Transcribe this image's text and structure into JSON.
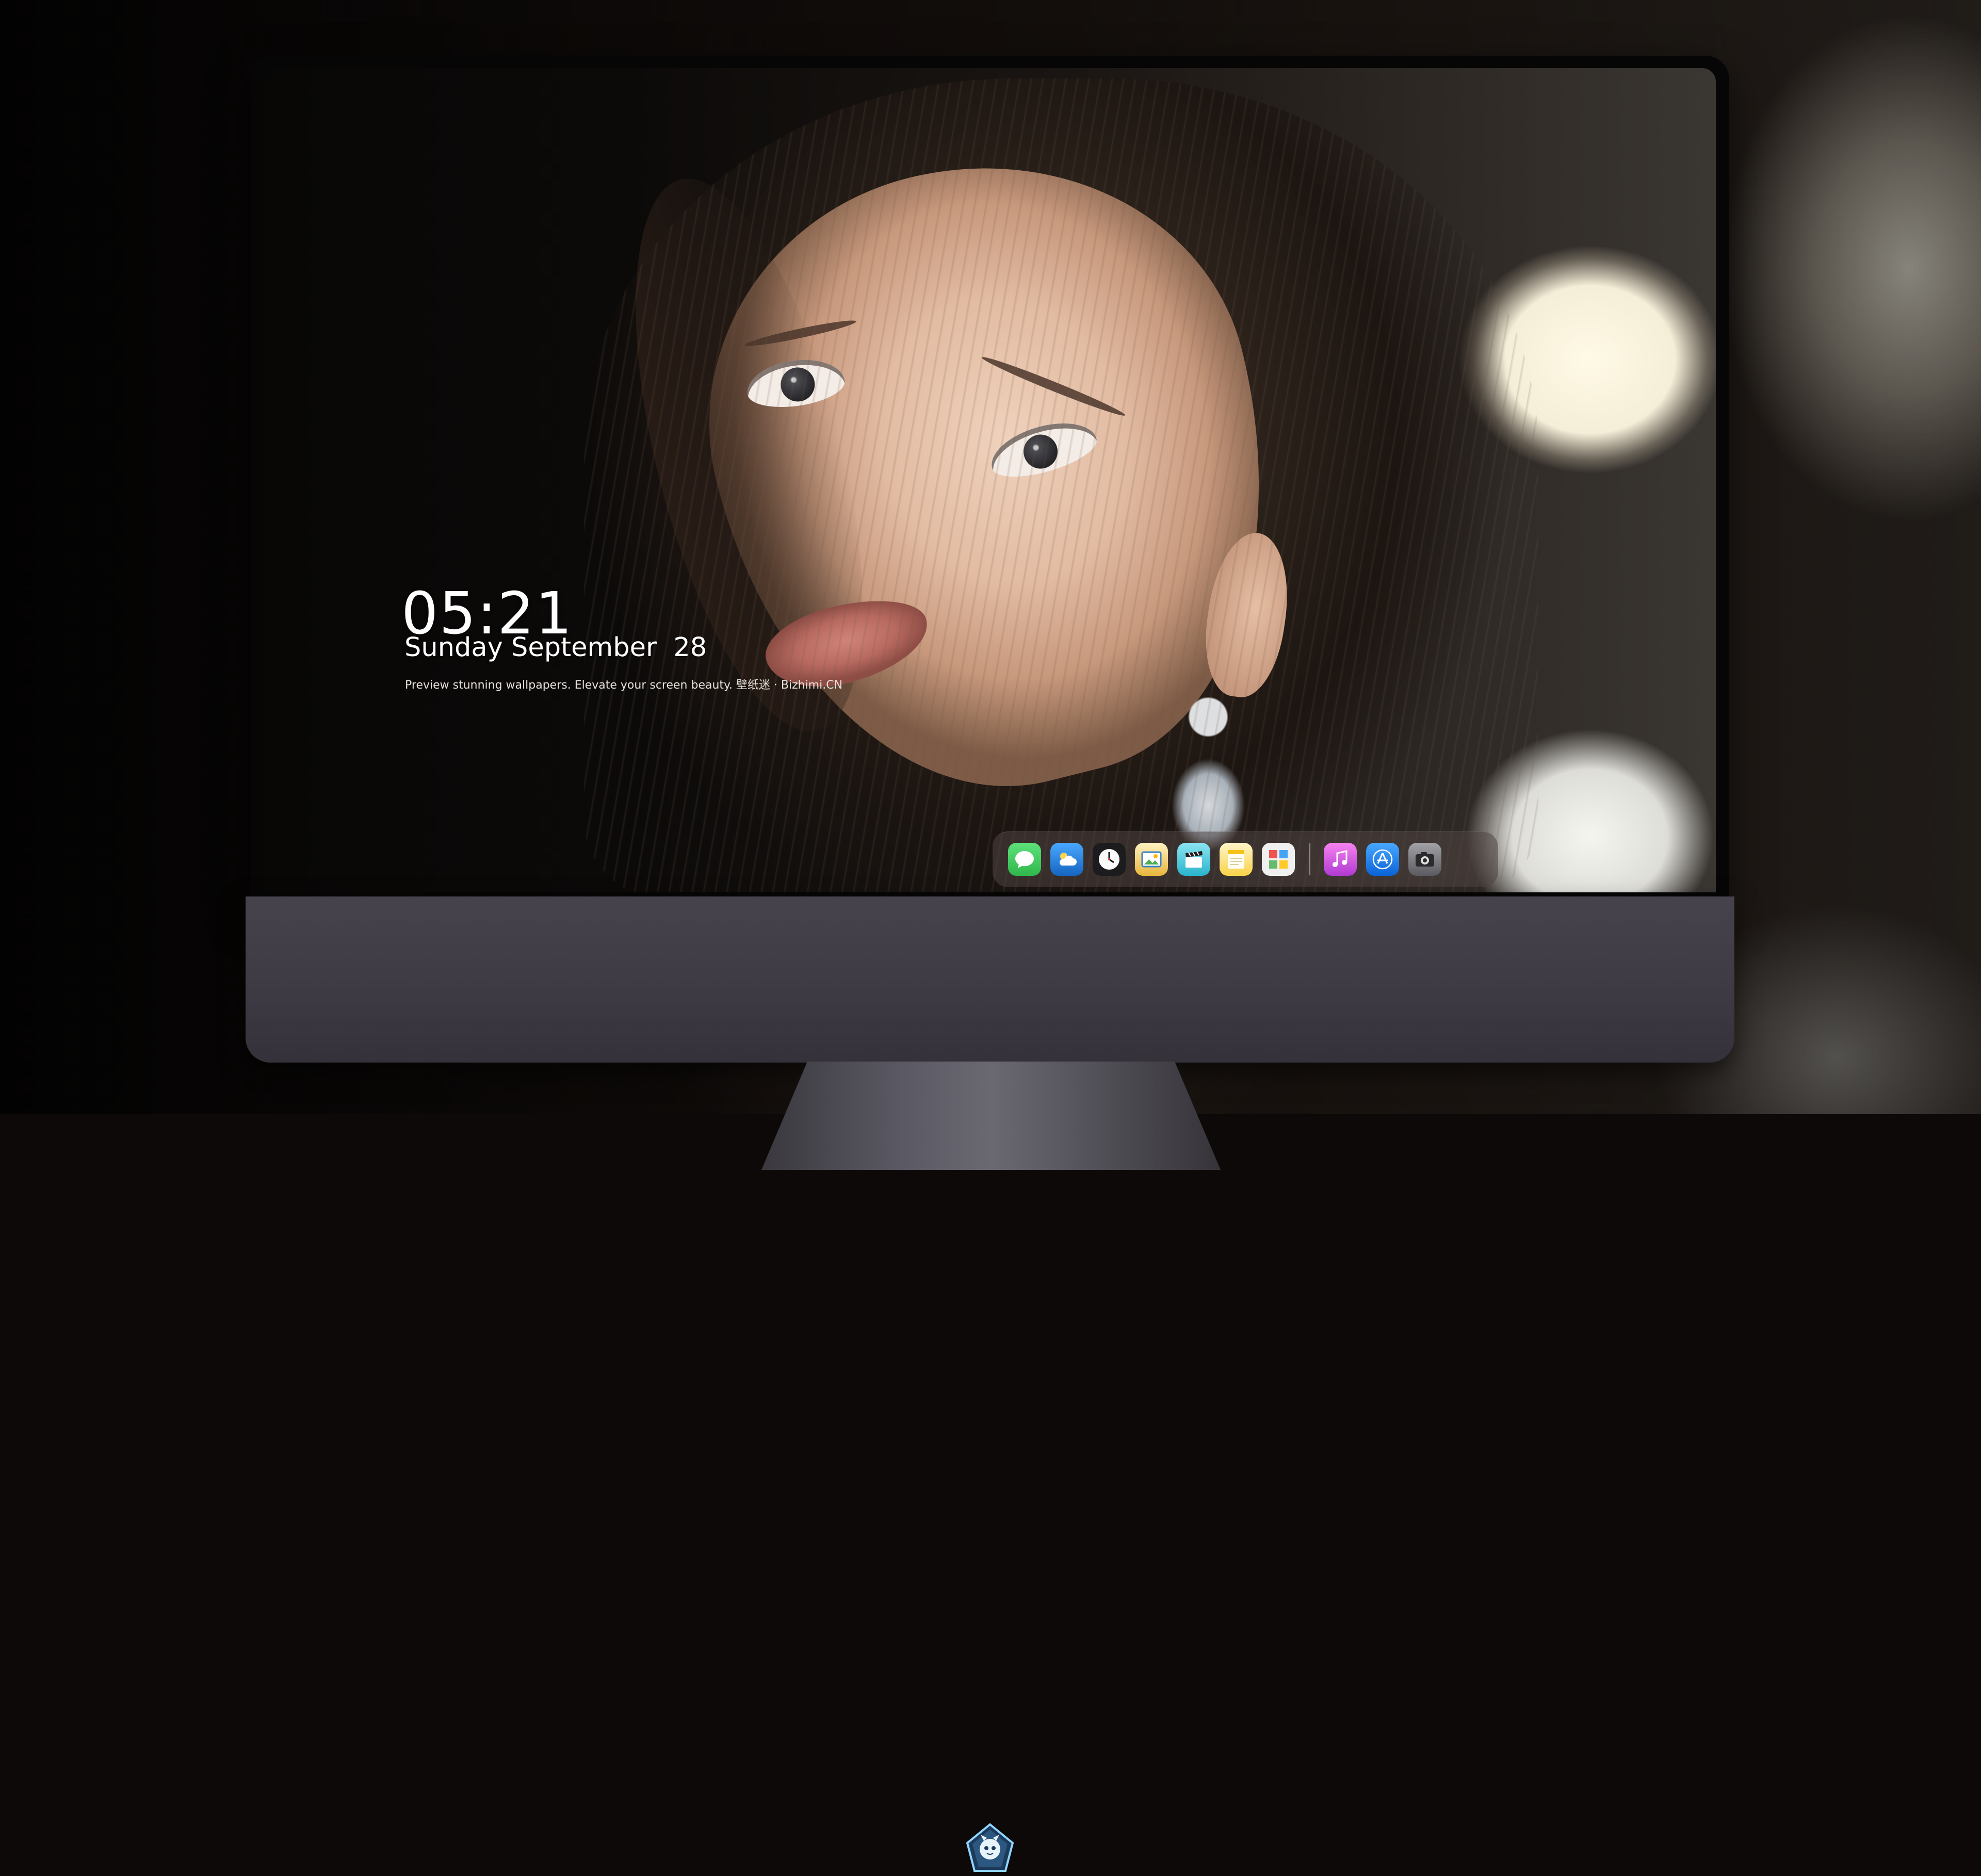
{
  "lock_screen": {
    "time": "05:21",
    "date": "Sunday September  28",
    "tagline": "Preview stunning wallpapers. Elevate your screen beauty. 壁纸迷 · Bizhimi.CN"
  },
  "dock": {
    "apps": [
      {
        "name": "messages",
        "icon": "chat-bubble-icon",
        "color": "#35c759"
      },
      {
        "name": "weather",
        "icon": "cloud-sun-icon",
        "color": "#1e88e5"
      },
      {
        "name": "clock",
        "icon": "clock-icon",
        "color": "#ffffff"
      },
      {
        "name": "preview",
        "icon": "image-viewer-icon",
        "color": "#f3c24c"
      },
      {
        "name": "final-cut",
        "icon": "clapperboard-icon",
        "color": "#5fd0e4"
      },
      {
        "name": "notes",
        "icon": "notes-icon",
        "color": "#fde27a"
      },
      {
        "name": "photo-booth",
        "icon": "photo-grid-icon",
        "color": "#7cc35a"
      },
      {
        "name": "itunes",
        "icon": "music-note-icon",
        "color": "#d64ad6"
      },
      {
        "name": "app-store",
        "icon": "app-store-icon",
        "color": "#1e7bf2"
      },
      {
        "name": "screenshot",
        "icon": "camera-icon",
        "color": "#8b8b8f"
      }
    ]
  },
  "colors": {
    "chin": "#47434d",
    "bezel": "#060606",
    "dock_bg": "rgba(80,70,68,0.55)"
  }
}
